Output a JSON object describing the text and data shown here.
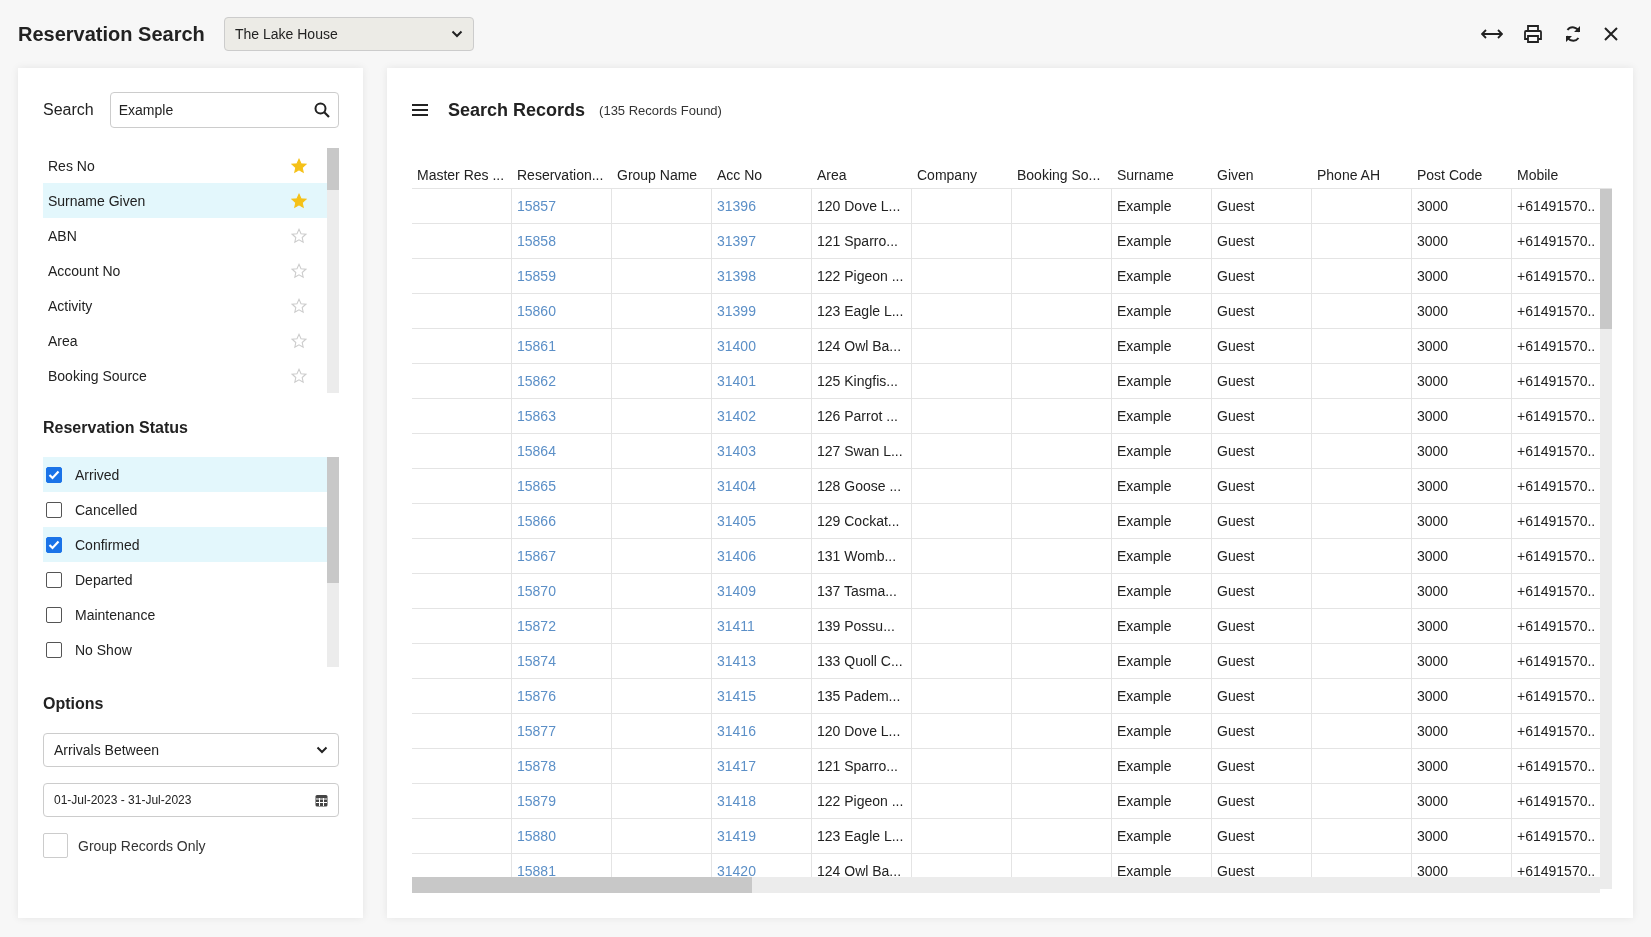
{
  "window": {
    "title": "Reservation Search",
    "property_select": "The Lake House"
  },
  "search": {
    "label": "Search",
    "value": "Example",
    "fields": [
      {
        "label": "Res No",
        "starred": true,
        "selected": false
      },
      {
        "label": "Surname Given",
        "starred": true,
        "selected": true
      },
      {
        "label": "ABN",
        "starred": false,
        "selected": false
      },
      {
        "label": "Account No",
        "starred": false,
        "selected": false
      },
      {
        "label": "Activity",
        "starred": false,
        "selected": false
      },
      {
        "label": "Area",
        "starred": false,
        "selected": false
      },
      {
        "label": "Booking Source",
        "starred": false,
        "selected": false
      }
    ]
  },
  "reservation_status": {
    "title": "Reservation Status",
    "items": [
      {
        "label": "Arrived",
        "checked": true
      },
      {
        "label": "Cancelled",
        "checked": false
      },
      {
        "label": "Confirmed",
        "checked": true
      },
      {
        "label": "Departed",
        "checked": false
      },
      {
        "label": "Maintenance",
        "checked": false
      },
      {
        "label": "No Show",
        "checked": false
      }
    ]
  },
  "options": {
    "title": "Options",
    "filter_select": "Arrivals Between",
    "date_range": "01-Jul-2023 - 31-Jul-2023",
    "group_records_only": {
      "label": "Group Records Only",
      "checked": false
    }
  },
  "results": {
    "title": "Search Records",
    "count": "(135 Records Found)",
    "columns": [
      {
        "label": "Master Res ..."
      },
      {
        "label": "Reservation...",
        "kind": "link"
      },
      {
        "label": "Group Name"
      },
      {
        "label": "Acc No",
        "kind": "link"
      },
      {
        "label": "Area",
        "kind": "text"
      },
      {
        "label": "Company"
      },
      {
        "label": "Booking So..."
      },
      {
        "label": "Surname",
        "kind": "text"
      },
      {
        "label": "Given",
        "kind": "text"
      },
      {
        "label": "Phone AH"
      },
      {
        "label": "Post Code",
        "kind": "text"
      },
      {
        "label": "Mobile",
        "kind": "text"
      }
    ],
    "rows": [
      [
        null,
        "15857",
        null,
        "31396",
        "120 Dove L...",
        null,
        null,
        "Example",
        "Guest",
        null,
        "3000",
        "+61491570.."
      ],
      [
        null,
        "15858",
        null,
        "31397",
        "121 Sparro...",
        null,
        null,
        "Example",
        "Guest",
        null,
        "3000",
        "+61491570.."
      ],
      [
        null,
        "15859",
        null,
        "31398",
        "122 Pigeon ...",
        null,
        null,
        "Example",
        "Guest",
        null,
        "3000",
        "+61491570.."
      ],
      [
        null,
        "15860",
        null,
        "31399",
        "123 Eagle L...",
        null,
        null,
        "Example",
        "Guest",
        null,
        "3000",
        "+61491570.."
      ],
      [
        null,
        "15861",
        null,
        "31400",
        "124 Owl Ba...",
        null,
        null,
        "Example",
        "Guest",
        null,
        "3000",
        "+61491570.."
      ],
      [
        null,
        "15862",
        null,
        "31401",
        "125 Kingfis...",
        null,
        null,
        "Example",
        "Guest",
        null,
        "3000",
        "+61491570.."
      ],
      [
        null,
        "15863",
        null,
        "31402",
        "126 Parrot ...",
        null,
        null,
        "Example",
        "Guest",
        null,
        "3000",
        "+61491570.."
      ],
      [
        null,
        "15864",
        null,
        "31403",
        "127 Swan L...",
        null,
        null,
        "Example",
        "Guest",
        null,
        "3000",
        "+61491570.."
      ],
      [
        null,
        "15865",
        null,
        "31404",
        "128 Goose ...",
        null,
        null,
        "Example",
        "Guest",
        null,
        "3000",
        "+61491570.."
      ],
      [
        null,
        "15866",
        null,
        "31405",
        "129 Cockat...",
        null,
        null,
        "Example",
        "Guest",
        null,
        "3000",
        "+61491570.."
      ],
      [
        null,
        "15867",
        null,
        "31406",
        "131 Womb...",
        null,
        null,
        "Example",
        "Guest",
        null,
        "3000",
        "+61491570.."
      ],
      [
        null,
        "15870",
        null,
        "31409",
        "137 Tasma...",
        null,
        null,
        "Example",
        "Guest",
        null,
        "3000",
        "+61491570.."
      ],
      [
        null,
        "15872",
        null,
        "31411",
        "139 Possu...",
        null,
        null,
        "Example",
        "Guest",
        null,
        "3000",
        "+61491570.."
      ],
      [
        null,
        "15874",
        null,
        "31413",
        "133 Quoll C...",
        null,
        null,
        "Example",
        "Guest",
        null,
        "3000",
        "+61491570.."
      ],
      [
        null,
        "15876",
        null,
        "31415",
        "135 Padem...",
        null,
        null,
        "Example",
        "Guest",
        null,
        "3000",
        "+61491570.."
      ],
      [
        null,
        "15877",
        null,
        "31416",
        "120 Dove L...",
        null,
        null,
        "Example",
        "Guest",
        null,
        "3000",
        "+61491570.."
      ],
      [
        null,
        "15878",
        null,
        "31417",
        "121 Sparro...",
        null,
        null,
        "Example",
        "Guest",
        null,
        "3000",
        "+61491570.."
      ],
      [
        null,
        "15879",
        null,
        "31418",
        "122 Pigeon ...",
        null,
        null,
        "Example",
        "Guest",
        null,
        "3000",
        "+61491570.."
      ],
      [
        null,
        "15880",
        null,
        "31419",
        "123 Eagle L...",
        null,
        null,
        "Example",
        "Guest",
        null,
        "3000",
        "+61491570.."
      ],
      [
        null,
        "15881",
        null,
        "31420",
        "124 Owl Ba...",
        null,
        null,
        "Example",
        "Guest",
        null,
        "3000",
        "+61491570.."
      ]
    ]
  }
}
